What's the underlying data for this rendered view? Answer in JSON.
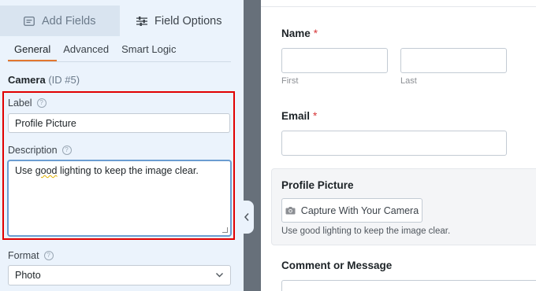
{
  "tabs": {
    "add_fields": "Add Fields",
    "field_options": "Field Options"
  },
  "subtabs": [
    "General",
    "Advanced",
    "Smart Logic"
  ],
  "field": {
    "name": "Camera",
    "id": "(ID #5)"
  },
  "label_field": {
    "label": "Label",
    "value": "Profile Picture"
  },
  "description_field": {
    "label": "Description",
    "value_prefix": "Use ",
    "value_spell": "good",
    "value_suffix": " lighting to keep the image clear."
  },
  "format_field": {
    "label": "Format",
    "value": "Photo"
  },
  "preview": {
    "name_label": "Name",
    "required_mark": "*",
    "first": "First",
    "last": "Last",
    "email_label": "Email",
    "profile_label": "Profile Picture",
    "camera_button": "Capture With Your Camera",
    "profile_desc": "Use good lighting to keep the image clear.",
    "comment_label": "Comment or Message"
  },
  "colors": {
    "accent": "#e27730",
    "highlight": "#e10000",
    "required": "#d63638"
  },
  "help_icon": "?"
}
